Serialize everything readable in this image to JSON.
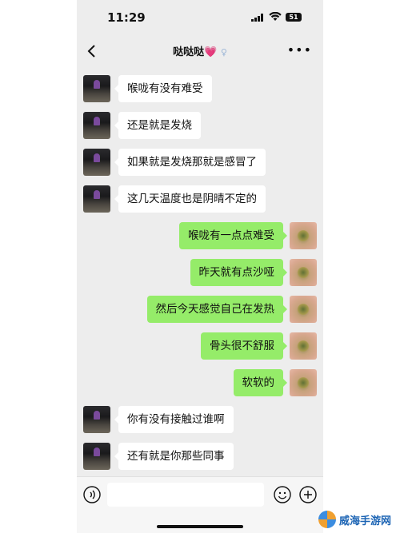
{
  "status_bar": {
    "time": "11:29",
    "battery": "51"
  },
  "header": {
    "title": "哒哒哒",
    "heart": "💗",
    "gender": "♀",
    "more": "•••"
  },
  "messages": [
    {
      "sender": "them",
      "text": "喉咙有没有难受"
    },
    {
      "sender": "them",
      "text": "还是就是发烧"
    },
    {
      "sender": "them",
      "text": "如果就是发烧那就是感冒了"
    },
    {
      "sender": "them",
      "text": "这几天温度也是阴晴不定的"
    },
    {
      "sender": "me",
      "text": "喉咙有一点点难受"
    },
    {
      "sender": "me",
      "text": "昨天就有点沙哑"
    },
    {
      "sender": "me",
      "text": "然后今天感觉自己在发热"
    },
    {
      "sender": "me",
      "text": "骨头很不舒服"
    },
    {
      "sender": "me",
      "text": "软软的"
    },
    {
      "sender": "them",
      "text": "你有没有接触过谁啊"
    },
    {
      "sender": "them",
      "text": "还有就是你那些同事"
    }
  ],
  "input": {
    "value": ""
  },
  "watermark": {
    "text": "威海手游网"
  },
  "colors": {
    "my_bubble": "#95ec69",
    "their_bubble": "#ffffff",
    "background": "#ededed"
  }
}
